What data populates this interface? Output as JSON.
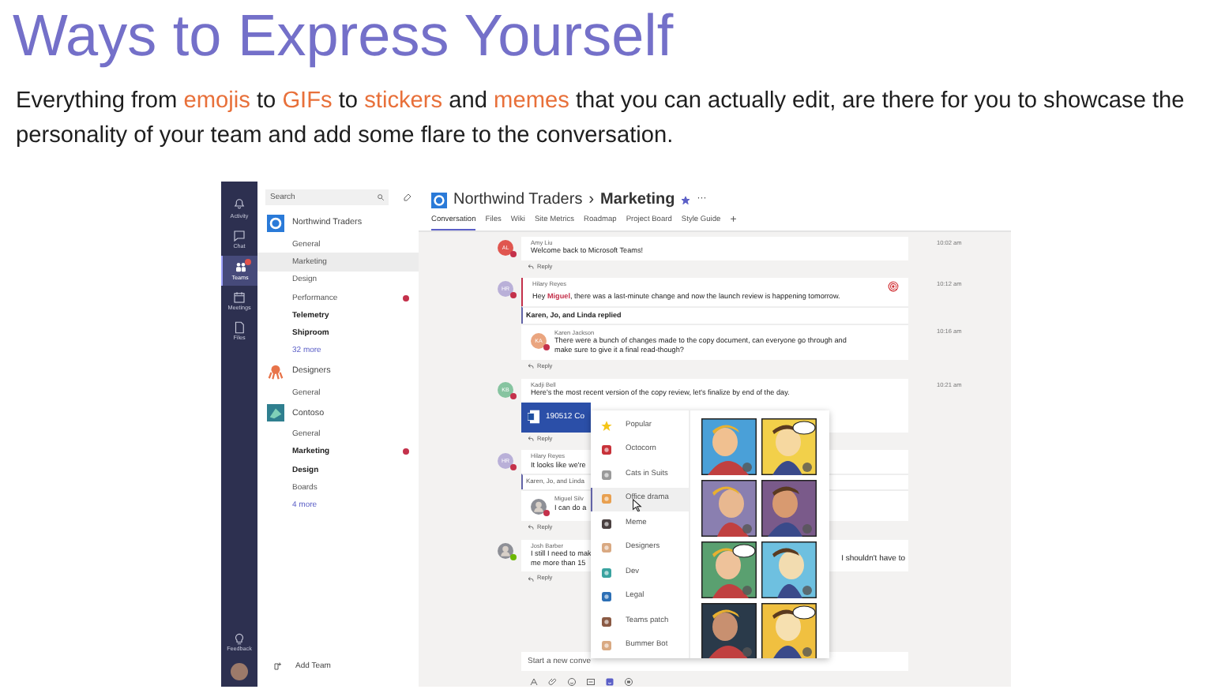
{
  "slide": {
    "title": "Ways to Express Yourself",
    "body_lines": [
      "Everything from **emojis** to **GIFs** to **stickers** and **memes** that you can actually edit, are there for you to showcase the",
      "personality of your team and add some flare to the conversation."
    ]
  },
  "app": {
    "rail": [
      {
        "label": "Activity",
        "kind": "bell",
        "selected": false,
        "alert": false
      },
      {
        "label": "Chat",
        "kind": "chat",
        "selected": false,
        "alert": false
      },
      {
        "label": "Teams",
        "kind": "teams",
        "selected": true,
        "alert": true
      },
      {
        "label": "Meetings",
        "kind": "calendar",
        "selected": false,
        "alert": false
      },
      {
        "label": "Files",
        "kind": "file",
        "selected": false,
        "alert": false
      }
    ],
    "rail_bottom": [
      {
        "label": "Feedback",
        "kind": "bulb",
        "selected": false,
        "alert": false
      }
    ],
    "search": {
      "placeholder": "Search"
    },
    "teams": [
      {
        "name": "Northwind Traders",
        "kind": "northwind",
        "channels": [
          {
            "label": "General",
            "kind": "channel",
            "selected": false,
            "unread": false,
            "alert": false
          },
          {
            "label": "Marketing",
            "kind": "channel",
            "selected": true,
            "unread": false,
            "alert": false
          },
          {
            "label": "Design",
            "kind": "channel",
            "selected": false,
            "unread": false,
            "alert": false
          },
          {
            "label": "Performance",
            "kind": "channel",
            "selected": false,
            "unread": false,
            "alert": true
          },
          {
            "label": "Telemetry",
            "kind": "channel",
            "selected": false,
            "unread": true,
            "alert": false
          },
          {
            "label": "Shiproom",
            "kind": "channel",
            "selected": false,
            "unread": true,
            "alert": false
          },
          {
            "label": "32 more",
            "kind": "more",
            "selected": false,
            "unread": false,
            "alert": false
          }
        ]
      },
      {
        "name": "Designers",
        "kind": "octopus",
        "channels": [
          {
            "label": "General",
            "kind": "channel",
            "selected": false,
            "unread": false,
            "alert": false
          }
        ]
      },
      {
        "name": "Contoso",
        "kind": "contoso",
        "channels": [
          {
            "label": "General",
            "kind": "channel",
            "selected": false,
            "unread": false,
            "alert": false
          },
          {
            "label": "Marketing",
            "kind": "channel",
            "selected": false,
            "unread": true,
            "alert": true
          },
          {
            "label": "Design",
            "kind": "channel",
            "selected": false,
            "unread": true,
            "alert": false
          },
          {
            "label": "Boards",
            "kind": "channel",
            "selected": false,
            "unread": false,
            "alert": false
          },
          {
            "label": "4 more",
            "kind": "more",
            "selected": false,
            "unread": false,
            "alert": false
          }
        ]
      }
    ],
    "add_team": "Add Team",
    "header": {
      "team": "Northwind Traders",
      "separator": "›",
      "channel": "Marketing",
      "favorite": true,
      "more": "···"
    },
    "tabs": [
      {
        "label": "Conversation",
        "selected": true
      },
      {
        "label": "Files",
        "selected": false
      },
      {
        "label": "Wiki",
        "selected": false
      },
      {
        "label": "Site Metrics",
        "selected": false
      },
      {
        "label": "Roadmap",
        "selected": false
      },
      {
        "label": "Project Board",
        "selected": false
      },
      {
        "label": "Style Guide",
        "selected": false
      }
    ],
    "add_tab": "+",
    "messages": [
      {
        "author": "Amy Liu",
        "avatar": {
          "kind": "initials",
          "initials": "AL",
          "color": "#e0564f",
          "presence_dot": {
            "color": "#c4314b"
          }
        },
        "time": "10:02 am",
        "lines": [
          "Welcome back to Microsoft Teams!"
        ],
        "reply": "Reply"
      },
      {
        "author": "Hilary Reyes",
        "avatar": {
          "kind": "initials",
          "initials": "HR",
          "color": "#b9b0d8",
          "presence_dot": {
            "color": "#c4314b"
          }
        },
        "time": "10:12 am",
        "lines": [
          "Hey **Miguel**, there was a last-minute change and now the launch review is happening tomorrow."
        ],
        "important": true,
        "mention": true,
        "replied": {
          "text": "Karen, Jo, and Linda replied",
          "bold": true
        },
        "replies": [
          {
            "author": "Karen Jackson",
            "avatar": {
              "kind": "initials",
              "initials": "KA",
              "color": "#eaa57f",
              "presence_dot": {
                "color": "#c4314b"
              }
            },
            "time": "10:16 am",
            "lines": [
              "There were a bunch of changes made to the copy document, can everyone go through and",
              "make sure to give it a final read-though?"
            ]
          }
        ],
        "reply": "Reply"
      },
      {
        "author": "Kadji Bell",
        "avatar": {
          "kind": "initials",
          "initials": "KB",
          "color": "#86c4a0",
          "presence_dot": {
            "color": "#c4314b"
          }
        },
        "time": "10:21 am",
        "lines": [
          "Here's the most recent version of the copy review, let's finalize by end of the day."
        ],
        "file": "190512 Co",
        "reply": "Reply"
      },
      {
        "author": "Hilary Reyes",
        "avatar": {
          "kind": "initials",
          "initials": "HR",
          "color": "#b9b0d8",
          "presence_dot": {
            "color": "#c4314b"
          }
        },
        "lines": [
          "It looks like we're"
        ],
        "replied": {
          "text": "Karen, Jo, and Linda",
          "bold": false
        },
        "replies": [
          {
            "author": "Miguel Silv",
            "avatar": {
              "presence_dot": {
                "color": "#c4314b"
              }
            },
            "lines": [
              "I can do a"
            ]
          }
        ],
        "reply": "Reply"
      },
      {
        "author": "Josh Barber",
        "avatar": {
          "presence_dot": {
            "color": "#6bb700"
          }
        },
        "lines": [
          "I still I need to mak",
          "me more than 15"
        ],
        "tail": "I shouldn't have to",
        "reply": "Reply"
      }
    ],
    "compose": {
      "placeholder": "Start a new conve"
    },
    "compose_tools": [
      {
        "kind": "format",
        "selected": false
      },
      {
        "kind": "attach",
        "selected": false
      },
      {
        "kind": "emoji",
        "selected": false
      },
      {
        "kind": "gif",
        "selected": false
      },
      {
        "kind": "sticker",
        "selected": true
      },
      {
        "kind": "meet",
        "selected": false
      }
    ],
    "sticker_picker": {
      "categories": [
        {
          "label": "Popular",
          "kind": "star",
          "selected": false
        },
        {
          "label": "Octocorn",
          "kind": "red",
          "selected": false
        },
        {
          "label": "Cats in Suits",
          "kind": "grey",
          "selected": false
        },
        {
          "label": "Office drama",
          "kind": "orange",
          "selected": true
        },
        {
          "label": "Meme",
          "kind": "dark",
          "selected": false
        },
        {
          "label": "Designers",
          "kind": "tan",
          "selected": false
        },
        {
          "label": "Dev",
          "kind": "teal",
          "selected": false
        },
        {
          "label": "Legal",
          "kind": "blue",
          "selected": false
        },
        {
          "label": "Teams patch",
          "kind": "brown",
          "selected": false
        },
        {
          "label": "Bummer Bot",
          "kind": "tan",
          "selected": false
        }
      ]
    }
  }
}
